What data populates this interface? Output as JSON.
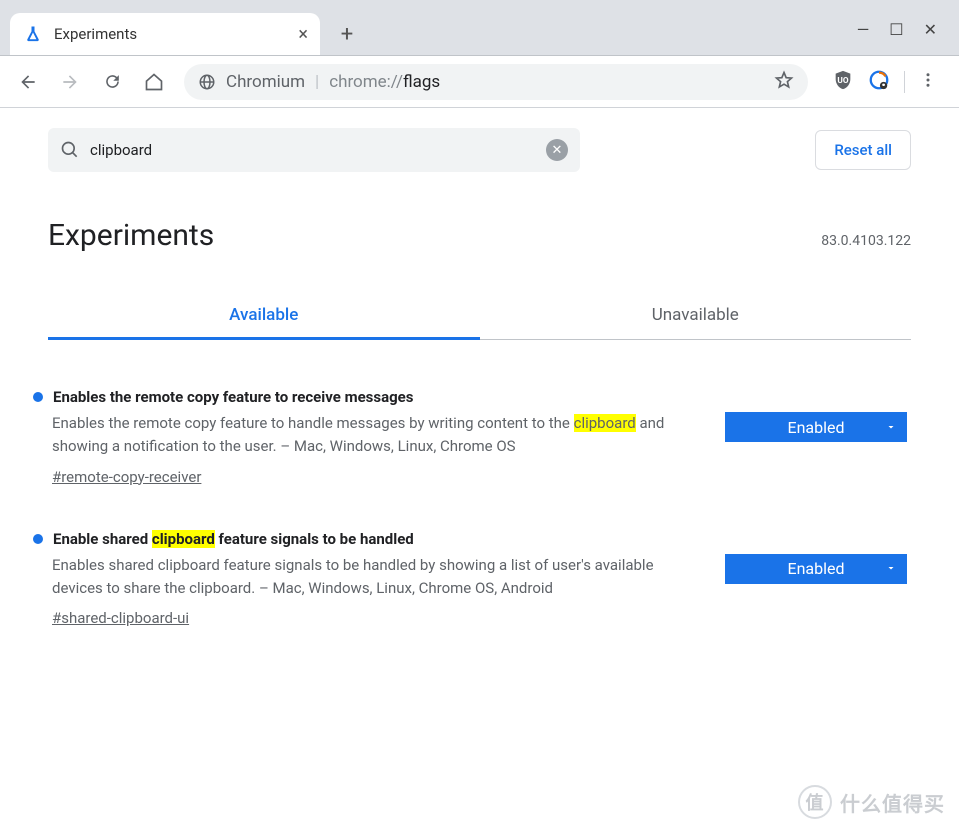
{
  "window": {
    "tab_title": "Experiments"
  },
  "omnibox": {
    "chromium_label": "Chromium",
    "separator": "|",
    "scheme": "chrome://",
    "path": "flags"
  },
  "search": {
    "value": "clipboard",
    "reset_label": "Reset all"
  },
  "header": {
    "title": "Experiments",
    "version": "83.0.4103.122"
  },
  "tabs": {
    "available": "Available",
    "unavailable": "Unavailable"
  },
  "flags": [
    {
      "title_pre": "Enables the remote copy feature to receive messages",
      "title_hl": "",
      "title_post": "",
      "desc_pre": "Enables the remote copy feature to handle messages by writing content to the ",
      "desc_hl": "clipboard",
      "desc_post": " and showing a notification to the user. – Mac, Windows, Linux, Chrome OS",
      "anchor": "#remote-copy-receiver",
      "status": "Enabled"
    },
    {
      "title_pre": "Enable shared ",
      "title_hl": "clipboard",
      "title_post": " feature signals to be handled",
      "desc_pre": "Enables shared clipboard feature signals to be handled by showing a list of user's available devices to share the clipboard. – Mac, Windows, Linux, Chrome OS, Android",
      "desc_hl": "",
      "desc_post": "",
      "anchor": "#shared-clipboard-ui",
      "status": "Enabled"
    }
  ],
  "watermark": "什么值得买"
}
